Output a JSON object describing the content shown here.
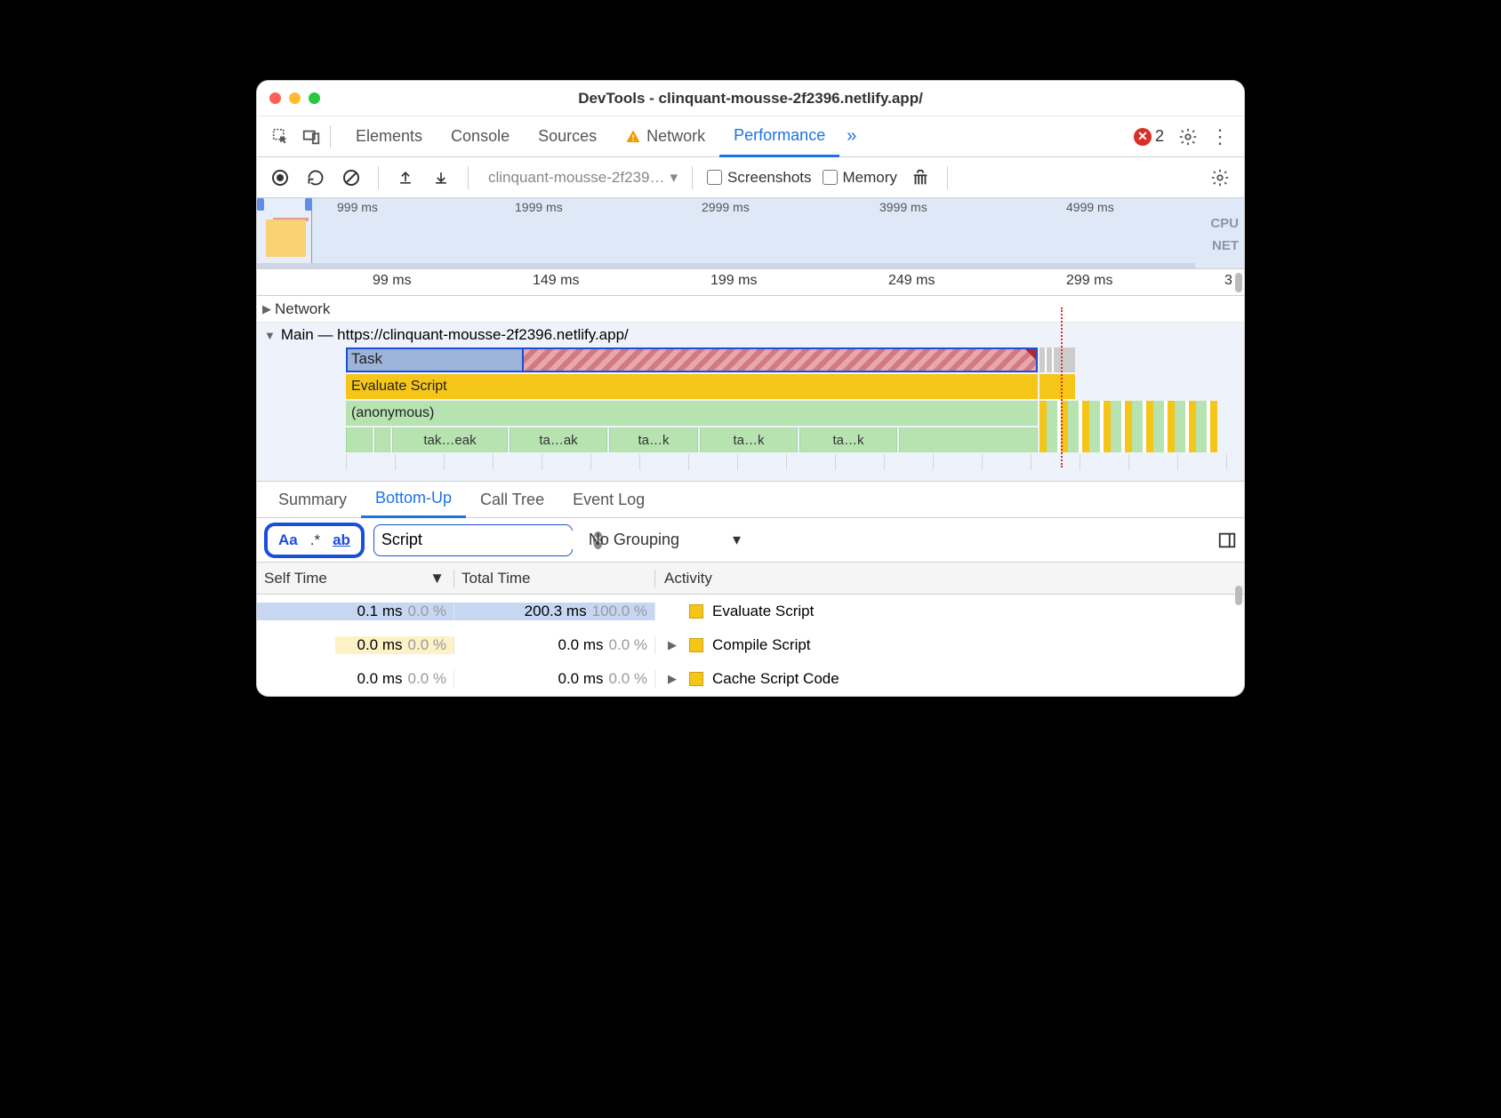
{
  "window": {
    "title": "DevTools - clinquant-mousse-2f2396.netlify.app/"
  },
  "toolbar": {
    "tabs": [
      "Elements",
      "Console",
      "Sources",
      "Network",
      "Performance"
    ],
    "active": "Performance",
    "network_warning": true,
    "error_count": "2"
  },
  "perf_toolbar": {
    "profile_name": "clinquant-mousse-2f239…",
    "screenshots_label": "Screenshots",
    "memory_label": "Memory"
  },
  "overview": {
    "ticks": [
      "999 ms",
      "1999 ms",
      "2999 ms",
      "3999 ms",
      "4999 ms"
    ],
    "right_labels": [
      "CPU",
      "NET"
    ]
  },
  "ruler": {
    "ticks": [
      "99 ms",
      "149 ms",
      "199 ms",
      "249 ms",
      "299 ms",
      "3"
    ]
  },
  "tracks": {
    "network_label": "Network",
    "main_label": "Main — https://clinquant-mousse-2f2396.netlify.app/",
    "task_label": "Task",
    "evaluate_label": "Evaluate Script",
    "anonymous_label": "(anonymous)",
    "segments": [
      "tak…eak",
      "ta…ak",
      "ta…k",
      "ta…k",
      "ta…k"
    ]
  },
  "subtabs": {
    "items": [
      "Summary",
      "Bottom-Up",
      "Call Tree",
      "Event Log"
    ],
    "active": "Bottom-Up"
  },
  "filter": {
    "match_case": "Aa",
    "regex": ".*",
    "whole_word": "ab",
    "query": "Script",
    "grouping": "No Grouping"
  },
  "table": {
    "cols": {
      "self": "Self Time",
      "total": "Total Time",
      "activity": "Activity"
    },
    "rows": [
      {
        "self_ms": "0.1 ms",
        "self_pct": "0.0 %",
        "total_ms": "200.3 ms",
        "total_pct": "100.0 %",
        "activity": "Evaluate Script",
        "expandable": false
      },
      {
        "self_ms": "0.0 ms",
        "self_pct": "0.0 %",
        "total_ms": "0.0 ms",
        "total_pct": "0.0 %",
        "activity": "Compile Script",
        "expandable": true
      },
      {
        "self_ms": "0.0 ms",
        "self_pct": "0.0 %",
        "total_ms": "0.0 ms",
        "total_pct": "0.0 %",
        "activity": "Cache Script Code",
        "expandable": true
      }
    ]
  }
}
